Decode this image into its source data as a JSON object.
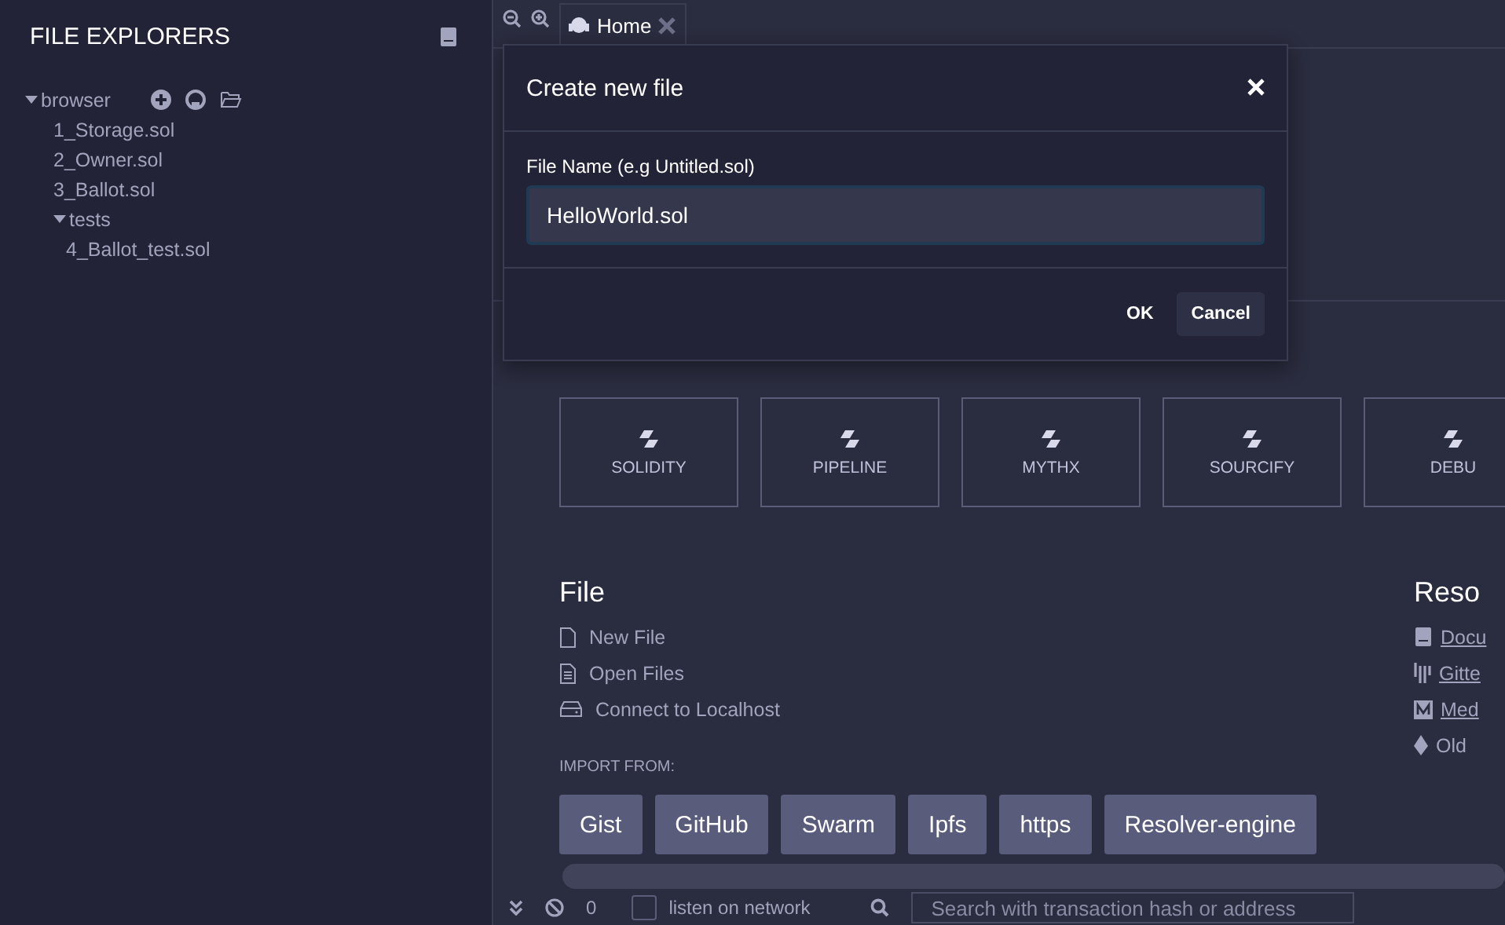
{
  "sidebar": {
    "title": "FILE EXPLORERS",
    "tree": [
      {
        "label": "browser",
        "expanded": true,
        "children": [
          {
            "label": "1_Storage.sol"
          },
          {
            "label": "2_Owner.sol"
          },
          {
            "label": "3_Ballot.sol"
          },
          {
            "label": "tests",
            "expanded": true,
            "children": [
              {
                "label": "4_Ballot_test.sol"
              }
            ]
          }
        ]
      }
    ]
  },
  "tabs": [
    {
      "label": "Home",
      "selected": true
    }
  ],
  "home": {
    "plugins": [
      {
        "label": "SOLIDITY"
      },
      {
        "label": "PIPELINE"
      },
      {
        "label": "MYTHX"
      },
      {
        "label": "SOURCIFY"
      },
      {
        "label": "DEBU"
      }
    ],
    "file": {
      "title": "File",
      "actions": [
        {
          "kind": "new",
          "label": "New File"
        },
        {
          "kind": "open",
          "label": "Open Files"
        },
        {
          "kind": "localhost",
          "label": "Connect to Localhost"
        }
      ],
      "import_label": "IMPORT FROM:",
      "import_buttons": [
        "Gist",
        "GitHub",
        "Swarm",
        "Ipfs",
        "https",
        "Resolver-engine"
      ]
    },
    "resources": {
      "title": "Reso",
      "links": [
        {
          "kind": "docs",
          "label": "Docu",
          "link": true
        },
        {
          "kind": "gitter",
          "label": "Gitte",
          "link": true
        },
        {
          "kind": "medium",
          "label": "Med",
          "link": true
        },
        {
          "kind": "eth",
          "label": "Old",
          "link": false
        }
      ]
    }
  },
  "terminal": {
    "count": "0",
    "listen": {
      "label": "listen on network",
      "checked": false
    },
    "search": {
      "placeholder": "Search with transaction hash or address"
    }
  },
  "modal": {
    "title": "Create new file",
    "field_label": "File Name (e.g Untitled.sol)",
    "value": "HelloWorld.sol",
    "buttons": [
      {
        "label": "OK",
        "kind": "primary"
      },
      {
        "label": "Cancel",
        "kind": "secondary"
      }
    ]
  }
}
